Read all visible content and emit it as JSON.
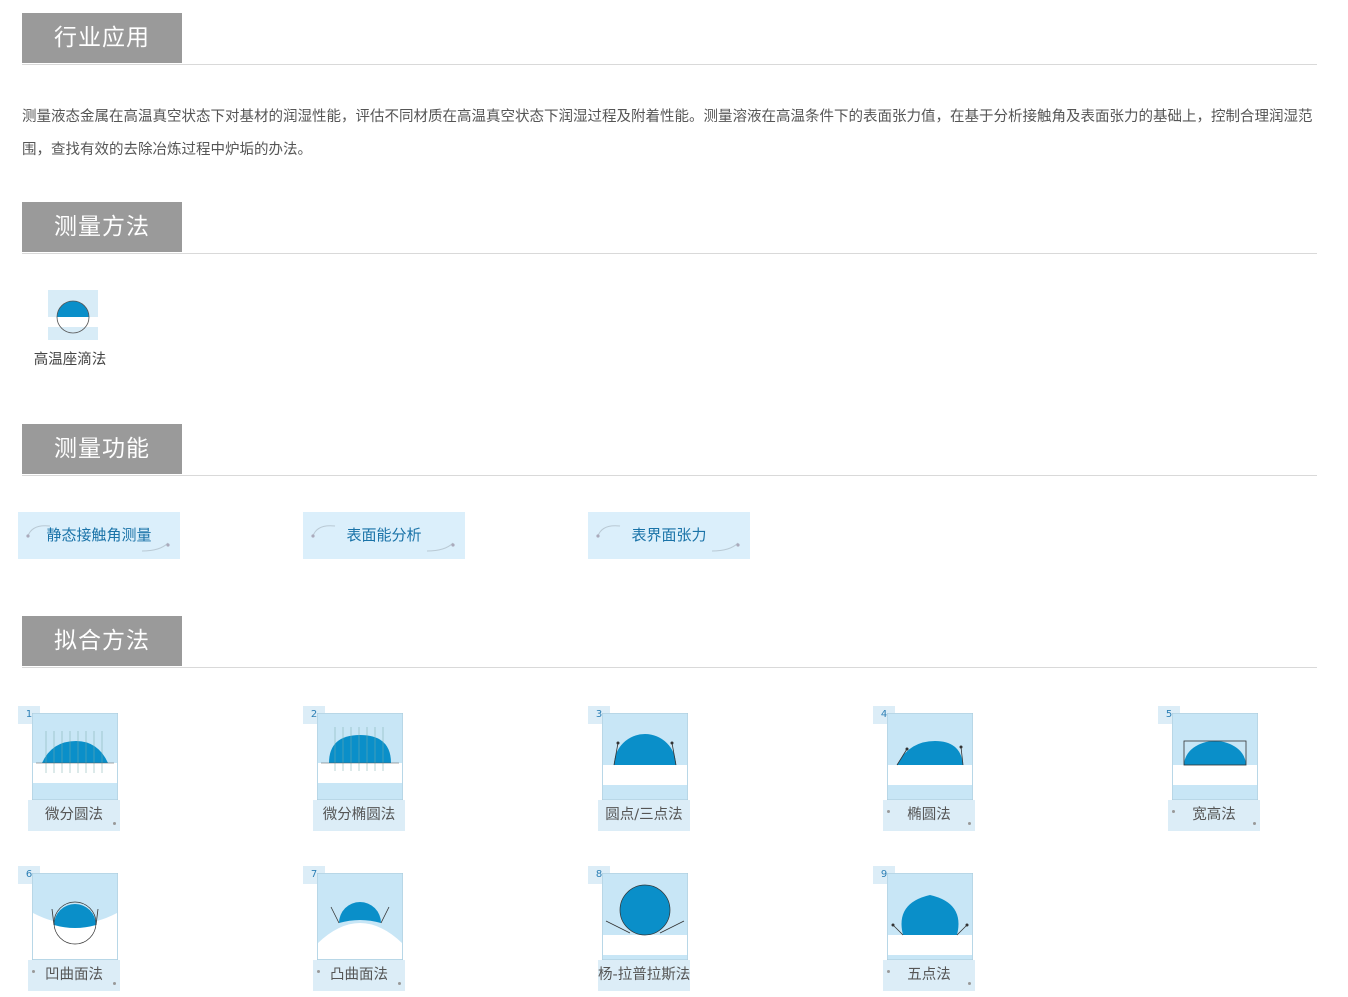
{
  "sections": {
    "industry": {
      "title": "行业应用"
    },
    "method": {
      "title": "测量方法"
    },
    "function": {
      "title": "测量功能"
    },
    "fitting": {
      "title": "拟合方法"
    }
  },
  "industry_text": "测量液态金属在高温真空状态下对基材的润湿性能，评估不同材质在高温真空状态下润湿过程及附着性能。测量溶液在高温条件下的表面张力值，在基于分析接触角及表面张力的基础上，控制合理润湿范围，查找有效的去除冶炼过程中炉垢的办法。",
  "method_item": {
    "label": "高温座滴法"
  },
  "functions": [
    {
      "label": "静态接触角测量"
    },
    {
      "label": "表面能分析"
    },
    {
      "label": "表界面张力"
    }
  ],
  "fitting_items": [
    {
      "num": "1",
      "label": "微分圆法"
    },
    {
      "num": "2",
      "label": "微分椭圆法"
    },
    {
      "num": "3",
      "label": "圆点/三点法"
    },
    {
      "num": "4",
      "label": "椭圆法"
    },
    {
      "num": "5",
      "label": "宽高法"
    },
    {
      "num": "6",
      "label": "凹曲面法"
    },
    {
      "num": "7",
      "label": "凸曲面法"
    },
    {
      "num": "8",
      "label": "杨-拉普拉斯法"
    },
    {
      "num": "9",
      "label": "五点法"
    }
  ],
  "colors": {
    "tab_bg": "#9a9a9a",
    "accent_blue": "#0a8fc9",
    "light_blue": "#dbeffb"
  }
}
